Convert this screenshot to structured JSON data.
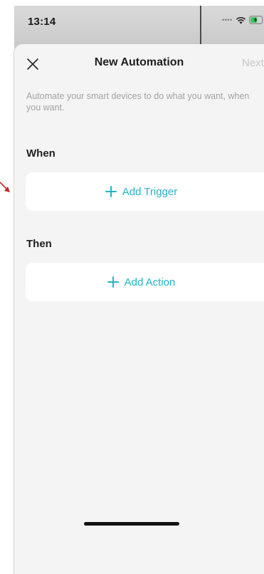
{
  "status_bar": {
    "time": "13:14"
  },
  "nav": {
    "title": "New Automation",
    "next_label": "Next",
    "close_icon": "close-icon"
  },
  "description": "Automate your smart devices to do what you want, when you want.",
  "when_section": {
    "label": "When",
    "add_label": "Add Trigger"
  },
  "then_section": {
    "label": "Then",
    "add_label": "Add Action"
  },
  "colors": {
    "accent": "#22b3c9",
    "sheet_background": "#f4f4f4",
    "annotation_arrow": "#c0262b"
  }
}
